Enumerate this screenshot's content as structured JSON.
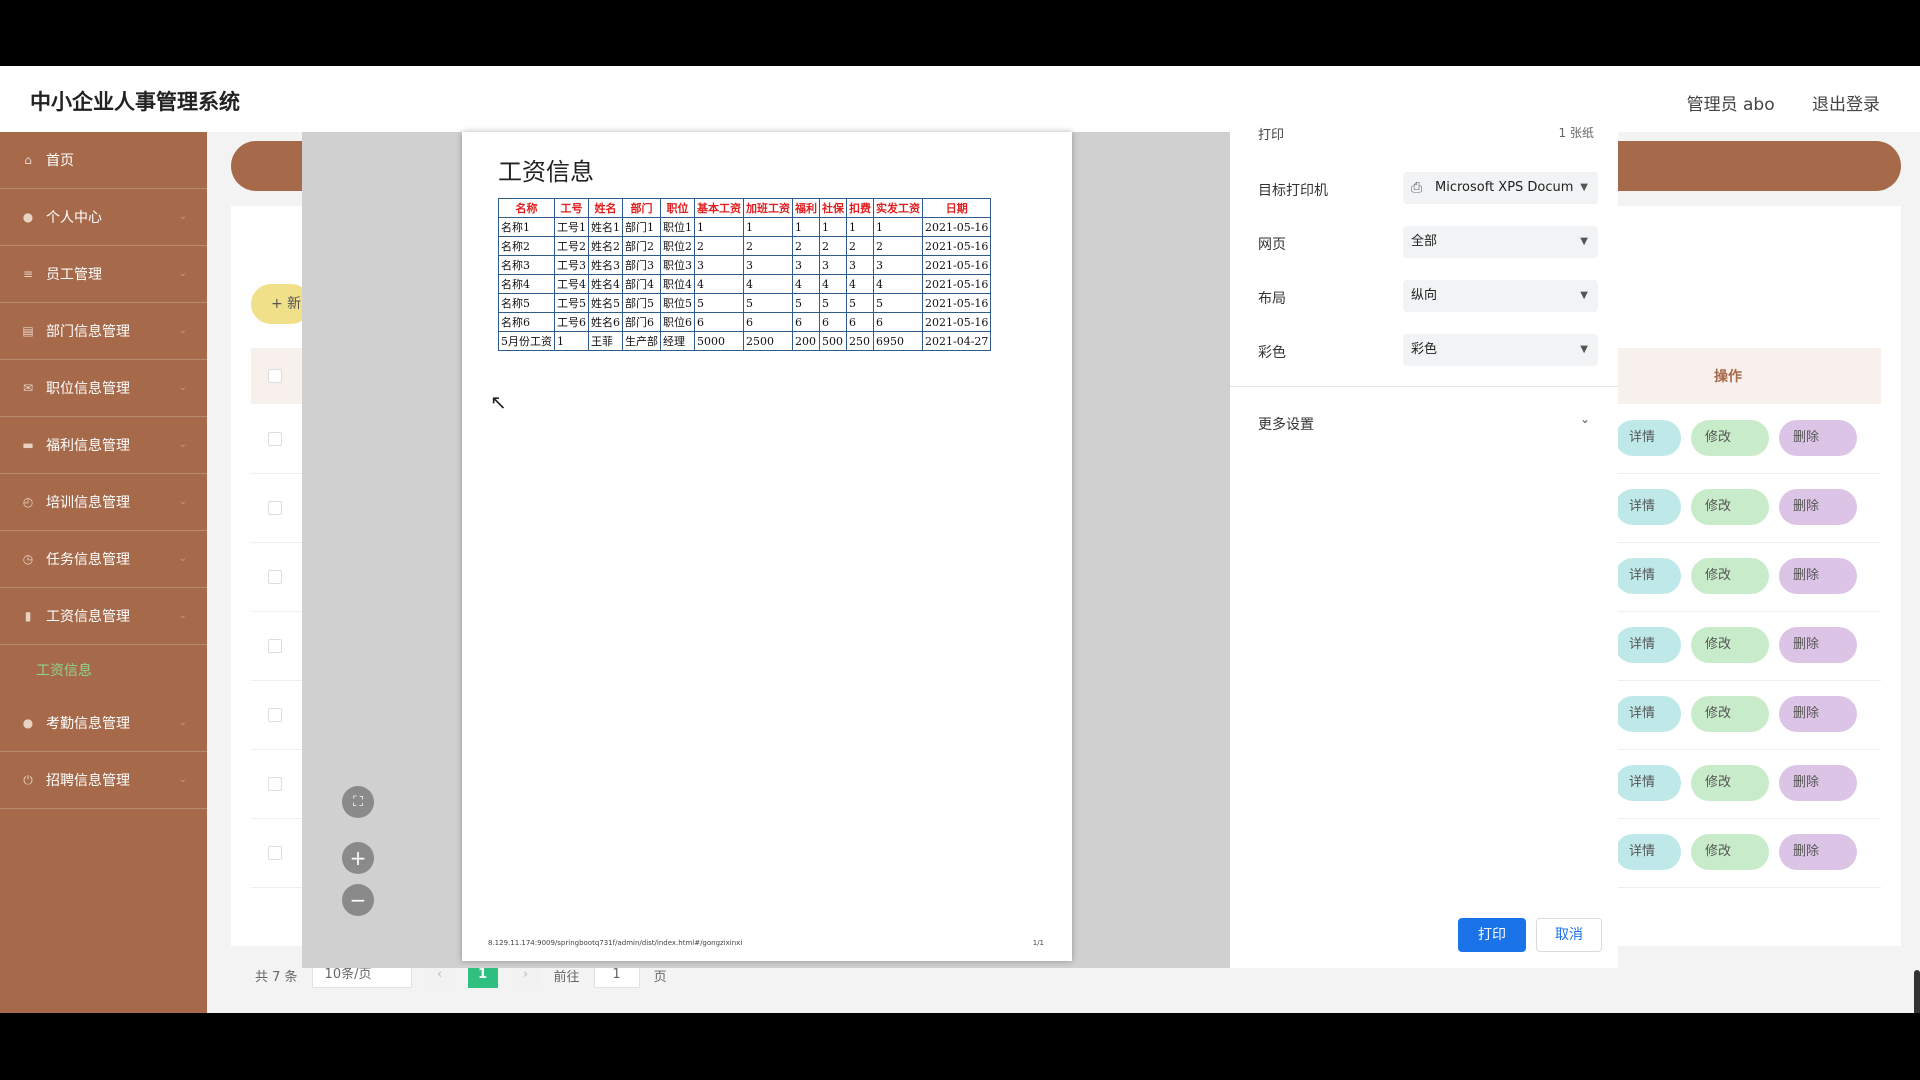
{
  "app": {
    "title": "中小企业人事管理系统",
    "admin": "管理员 abo",
    "logout": "退出登录"
  },
  "sidebar": {
    "items": [
      {
        "label": "首页",
        "icon": "home-icon",
        "glyph": "⌂"
      },
      {
        "label": "个人中心",
        "icon": "user-icon",
        "glyph": "●"
      },
      {
        "label": "员工管理",
        "icon": "list-icon",
        "glyph": "≡"
      },
      {
        "label": "部门信息管理",
        "icon": "building-icon",
        "glyph": "▤"
      },
      {
        "label": "职位信息管理",
        "icon": "mail-icon",
        "glyph": "✉"
      },
      {
        "label": "福利信息管理",
        "icon": "chat-icon",
        "glyph": "▬"
      },
      {
        "label": "培训信息管理",
        "icon": "clock-icon",
        "glyph": "◴"
      },
      {
        "label": "任务信息管理",
        "icon": "history-icon",
        "glyph": "◷"
      },
      {
        "label": "工资信息管理",
        "icon": "bar-chart-icon",
        "glyph": "▮"
      }
    ],
    "sub_item": "工资信息",
    "items_after": [
      {
        "label": "考勤信息管理",
        "icon": "user-icon",
        "glyph": "●"
      },
      {
        "label": "招聘信息管理",
        "icon": "power-icon",
        "glyph": "⏻"
      }
    ]
  },
  "main": {
    "add_button": "+ 新",
    "op_header": "操作",
    "row_actions": {
      "detail": "详情",
      "edit": "修改",
      "delete": "删除"
    },
    "pager": {
      "total": "共 7 条",
      "page_size": "10条/页",
      "current": "1",
      "goto_prefix": "前往",
      "goto_value": "1",
      "goto_suffix": "页"
    }
  },
  "preview": {
    "title": "工资信息",
    "headers": [
      "名称",
      "工号",
      "姓名",
      "部门",
      "职位",
      "基本工资",
      "加班工资",
      "福利",
      "社保",
      "扣费",
      "实发工资",
      "日期"
    ],
    "rows": [
      [
        "名称1",
        "工号1",
        "姓名1",
        "部门1",
        "职位1",
        "1",
        "1",
        "1",
        "1",
        "1",
        "1",
        "2021-05-16"
      ],
      [
        "名称2",
        "工号2",
        "姓名2",
        "部门2",
        "职位2",
        "2",
        "2",
        "2",
        "2",
        "2",
        "2",
        "2021-05-16"
      ],
      [
        "名称3",
        "工号3",
        "姓名3",
        "部门3",
        "职位3",
        "3",
        "3",
        "3",
        "3",
        "3",
        "3",
        "2021-05-16"
      ],
      [
        "名称4",
        "工号4",
        "姓名4",
        "部门4",
        "职位4",
        "4",
        "4",
        "4",
        "4",
        "4",
        "4",
        "2021-05-16"
      ],
      [
        "名称5",
        "工号5",
        "姓名5",
        "部门5",
        "职位5",
        "5",
        "5",
        "5",
        "5",
        "5",
        "5",
        "2021-05-16"
      ],
      [
        "名称6",
        "工号6",
        "姓名6",
        "部门6",
        "职位6",
        "6",
        "6",
        "6",
        "6",
        "6",
        "6",
        "2021-05-16"
      ],
      [
        "5月份工资",
        "1",
        "王菲",
        "生产部",
        "经理",
        "5000",
        "2500",
        "200",
        "500",
        "250",
        "6950",
        "2021-04-27"
      ]
    ],
    "footer_url": "8.129.11.174:9009/springbootq731f/admin/dist/index.html#/gongzixinxi",
    "footer_page": "1/1"
  },
  "print_settings": {
    "title_partial": "打印",
    "sheet_count_partial": "1 张纸",
    "printer_label": "目标打印机",
    "printer_value": "Microsoft XPS Docum",
    "pages_label": "网页",
    "pages_value": "全部",
    "layout_label": "布局",
    "layout_value": "纵向",
    "color_label": "彩色",
    "color_value": "彩色",
    "more_settings": "更多设置",
    "print_button": "打印",
    "cancel_button": "取消"
  }
}
